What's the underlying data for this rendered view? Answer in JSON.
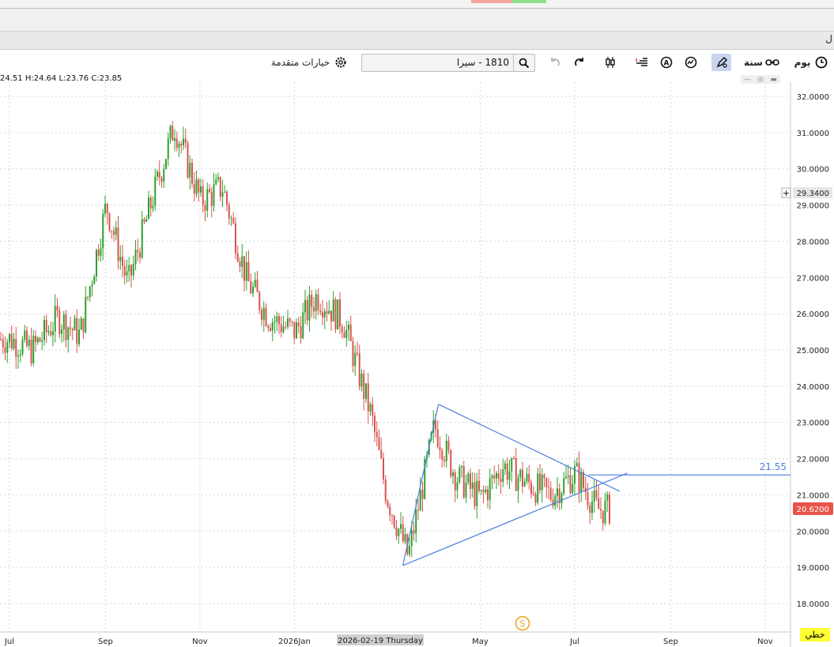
{
  "toolbar": {
    "period_day": "يوم",
    "period_year": "سنة",
    "search_value": "1810 - سيرا",
    "advanced_options": "خيارات متقدمة"
  },
  "window_edge_text": "ل",
  "ohlc": {
    "o": "24.51",
    "h": "H:24.64",
    "l": "L:23.76",
    "c": "C:23.85"
  },
  "style_button": "خطي",
  "marker_letter": "S",
  "crosshair_date": "2026-02-19 Thursday",
  "colors": {
    "up": "#2ca02c",
    "down": "#d9534f",
    "drawing": "#4a7fe0",
    "last_price_bg": "#e8534a"
  },
  "chart_data": {
    "type": "candlestick",
    "ylim": [
      17.5,
      32.5
    ],
    "y_ticks": [
      "32.0000",
      "31.0000",
      "30.0000",
      "29.0000",
      "28.0000",
      "27.0000",
      "26.0000",
      "25.0000",
      "24.0000",
      "23.0000",
      "22.0000",
      "21.0000",
      "20.0000",
      "19.0000",
      "18.0000"
    ],
    "x_tick_labels": [
      "Jul",
      "Sep",
      "Nov",
      "2026Jan",
      "May",
      "Jul",
      "Sep",
      "Nov"
    ],
    "last_price": "20.6200",
    "crosshair_price": "29.3400",
    "horizontal_line_label": "21.55",
    "horizontal_line_value": 21.55,
    "series_close_approx": [
      [
        "2025-07-01",
        25.3
      ],
      [
        "2025-07-15",
        25.0
      ],
      [
        "2025-08-01",
        25.9
      ],
      [
        "2025-08-15",
        25.4
      ],
      [
        "2025-09-01",
        29.0
      ],
      [
        "2025-09-15",
        26.8
      ],
      [
        "2025-10-01",
        29.2
      ],
      [
        "2025-10-15",
        31.2
      ],
      [
        "2025-11-01",
        29.1
      ],
      [
        "2025-11-15",
        29.5
      ],
      [
        "2025-12-01",
        26.9
      ],
      [
        "2025-12-15",
        25.9
      ],
      [
        "2026-01-01",
        25.5
      ],
      [
        "2026-01-15",
        26.5
      ],
      [
        "2026-02-01",
        25.8
      ],
      [
        "2026-02-19",
        23.2
      ],
      [
        "2026-03-01",
        21.0
      ],
      [
        "2026-03-15",
        19.3
      ],
      [
        "2026-04-01",
        22.9
      ],
      [
        "2026-04-15",
        21.5
      ],
      [
        "2026-05-01",
        20.9
      ],
      [
        "2026-05-15",
        21.8
      ],
      [
        "2026-06-01",
        21.3
      ],
      [
        "2026-06-15",
        21.0
      ],
      [
        "2026-07-01",
        21.6
      ],
      [
        "2026-07-15",
        20.6
      ]
    ],
    "trendlines": [
      {
        "from": [
          "2026-03-12",
          19.05
        ],
        "to": [
          "2026-04-04",
          23.5
        ]
      },
      {
        "from": [
          "2026-04-04",
          23.5
        ],
        "to": [
          "2026-07-30",
          21.1
        ]
      },
      {
        "from": [
          "2026-03-12",
          19.05
        ],
        "to": [
          "2026-08-04",
          21.6
        ]
      }
    ]
  }
}
